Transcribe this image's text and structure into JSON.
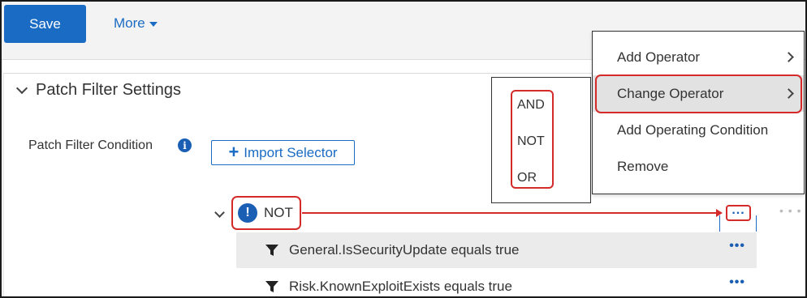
{
  "toolbar": {
    "save_label": "Save",
    "more_label": "More"
  },
  "section": {
    "title": "Patch Filter Settings"
  },
  "condition": {
    "label": "Patch Filter Condition",
    "import_label": "Import Selector"
  },
  "tree": {
    "root_operator": "NOT",
    "rows": [
      {
        "text": "General.IsSecurityUpdate equals true"
      },
      {
        "text": "Risk.KnownExploitExists equals true"
      }
    ]
  },
  "operator_menu": {
    "items": [
      "AND",
      "NOT",
      "OR"
    ]
  },
  "context_menu": {
    "items": [
      {
        "label": "Add Operator",
        "has_submenu": true
      },
      {
        "label": "Change Operator",
        "has_submenu": true,
        "highlighted": true
      },
      {
        "label": "Add Operating Condition",
        "has_submenu": false
      },
      {
        "label": "Remove",
        "has_submenu": false
      }
    ]
  },
  "colors": {
    "accent": "#1a6bc4",
    "highlight": "#d42a2a",
    "row_bg": "#ebebeb"
  }
}
